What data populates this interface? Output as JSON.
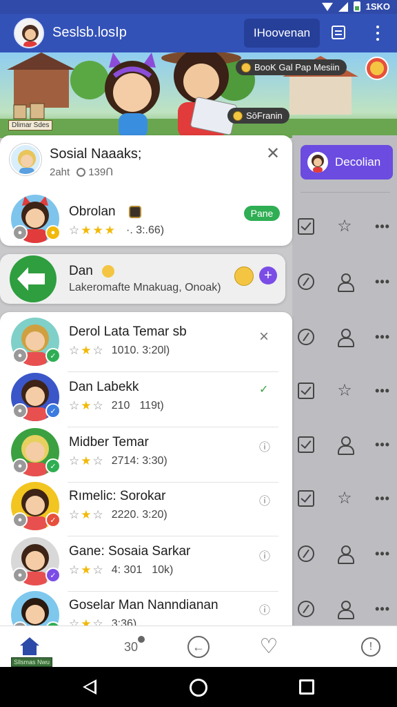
{
  "status_bar": {
    "time": "1SKO"
  },
  "app_bar": {
    "title": "Seslsb.losIp",
    "chip_label": "IHoovenan"
  },
  "banner": {
    "tag_top": "BooK Gal Pap Mesiin",
    "tag_bottom": "SōFranin",
    "small_label": "Dlimar Sdes"
  },
  "side": {
    "button_label": "Decolian",
    "rows": [
      {
        "left_icon": "checkbox-icon",
        "mid_icon": "star-icon"
      },
      {
        "left_icon": "compass-icon",
        "mid_icon": "person-icon"
      },
      {
        "left_icon": "compass-icon",
        "mid_icon": "person-icon"
      },
      {
        "left_icon": "checkbox-icon",
        "mid_icon": "star-icon"
      },
      {
        "left_icon": "checkbox-icon",
        "mid_icon": "person-icon"
      },
      {
        "left_icon": "checkbox-icon",
        "mid_icon": "star-icon"
      },
      {
        "left_icon": "compass-icon",
        "mid_icon": "person-icon"
      },
      {
        "left_icon": "compass-icon",
        "mid_icon": "person-icon"
      }
    ]
  },
  "header_card": {
    "title": "Sosial Naaaks;",
    "subtitle_count": "2aht",
    "subtitle_time": "139Ո"
  },
  "featured": {
    "name": "Obrolan",
    "meta": "·. 3:.66)",
    "pill": "Pane"
  },
  "chat_group": {
    "name": "Dan",
    "subtitle": "Lakeromafte Mnakuag, Onoak)"
  },
  "list": [
    {
      "name": "Derol Lata Temar",
      "suffix": "sb",
      "meta": "1010. 3:20l)",
      "trail": "×",
      "badge_color": "#2fae54"
    },
    {
      "name": "Dan Labekk",
      "suffix": "",
      "meta": "210",
      "meta2": "119t)",
      "trail": "✓",
      "badge_color": "#3a7be0"
    },
    {
      "name": "Midber Temar",
      "suffix": "",
      "meta": "2714: 3:30)",
      "trail": "ⓘ",
      "badge_color": "#2fae54"
    },
    {
      "name": "Rımelic: Sorokar",
      "suffix": "",
      "meta": "2220. 3:20)",
      "trail": "ⓘ",
      "badge_color": "#e6503c"
    },
    {
      "name": "Gane: Sosaia Sarkar",
      "suffix": "",
      "meta": "4: 301",
      "meta2": "10k)",
      "trail": "ⓘ",
      "badge_color": "#7b4de6"
    },
    {
      "name": "Goselar Man Nanndianan",
      "suffix": "",
      "meta": "3:36)",
      "trail": "ⓘ",
      "badge_color": "#2fae54"
    }
  ],
  "bottom_nav": {
    "count": "30",
    "label": "Sllsmas Nwu"
  }
}
